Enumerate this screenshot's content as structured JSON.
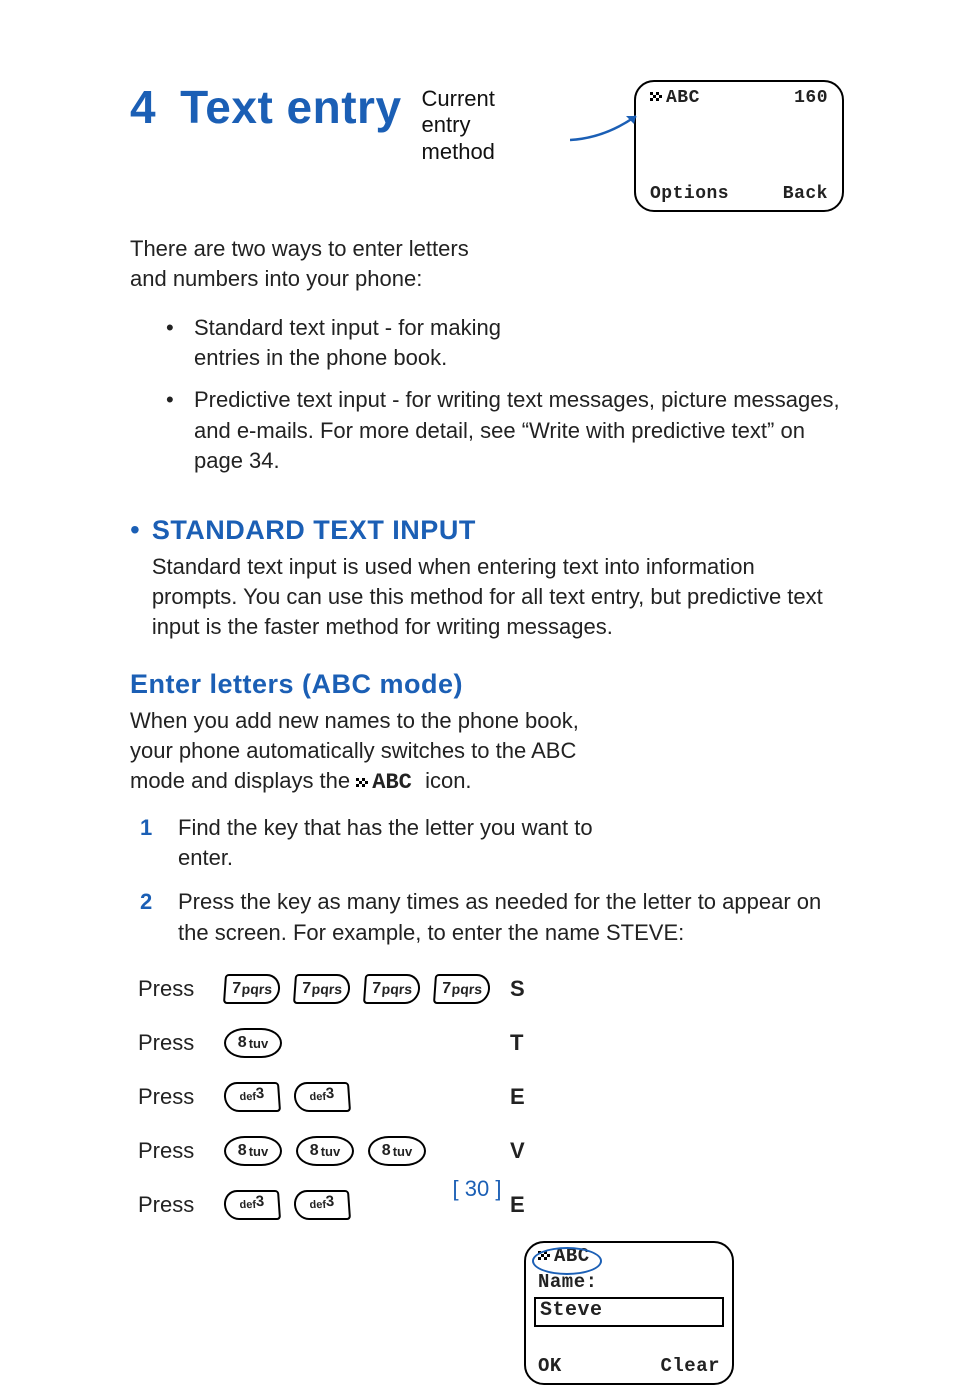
{
  "chapter": {
    "num": "4",
    "title": "Text entry"
  },
  "caption": "Current entry method",
  "phone1": {
    "mode": "ABC",
    "count": "160",
    "left": "Options",
    "right": "Back"
  },
  "intro": "There are two ways to enter letters and numbers into your phone:",
  "bullets": [
    "Standard text input - for making entries in the phone book.",
    "Predictive text input - for writing text messages, picture messages, and e-mails. For more detail, see “Write with predictive text” on page 34."
  ],
  "h2a": "Standard text input",
  "paraA": "Standard text input is used when entering text into information prompts. You can use this method for all text entry, but predictive text input is the faster method for writing messages.",
  "h2b": "Enter letters (ABC mode)",
  "paraB_pre": "When you add new names to the phone book, your phone automatically switches to the ABC mode and displays the ",
  "paraB_icon": "ABC",
  "paraB_post": " icon.",
  "phone2": {
    "mode": "ABC",
    "label": "Name:",
    "value": "Steve",
    "left": "OK",
    "right": "Clear"
  },
  "steps": [
    "Find the key that has the letter you want to enter.",
    "Press the key as many times as needed for the letter to appear on the screen. For example, to enter the name STEVE:"
  ],
  "press_label": "Press",
  "press_rows": [
    {
      "key": "7",
      "times": 4,
      "letter": "S"
    },
    {
      "key": "8",
      "times": 1,
      "letter": "T"
    },
    {
      "key": "3",
      "times": 2,
      "letter": "E"
    },
    {
      "key": "8",
      "times": 3,
      "letter": "V"
    },
    {
      "key": "3",
      "times": 2,
      "letter": "E"
    }
  ],
  "key_labels": {
    "7": "pqrs",
    "8": "tuv",
    "3": "def"
  },
  "page_number": "[ 30 ]"
}
